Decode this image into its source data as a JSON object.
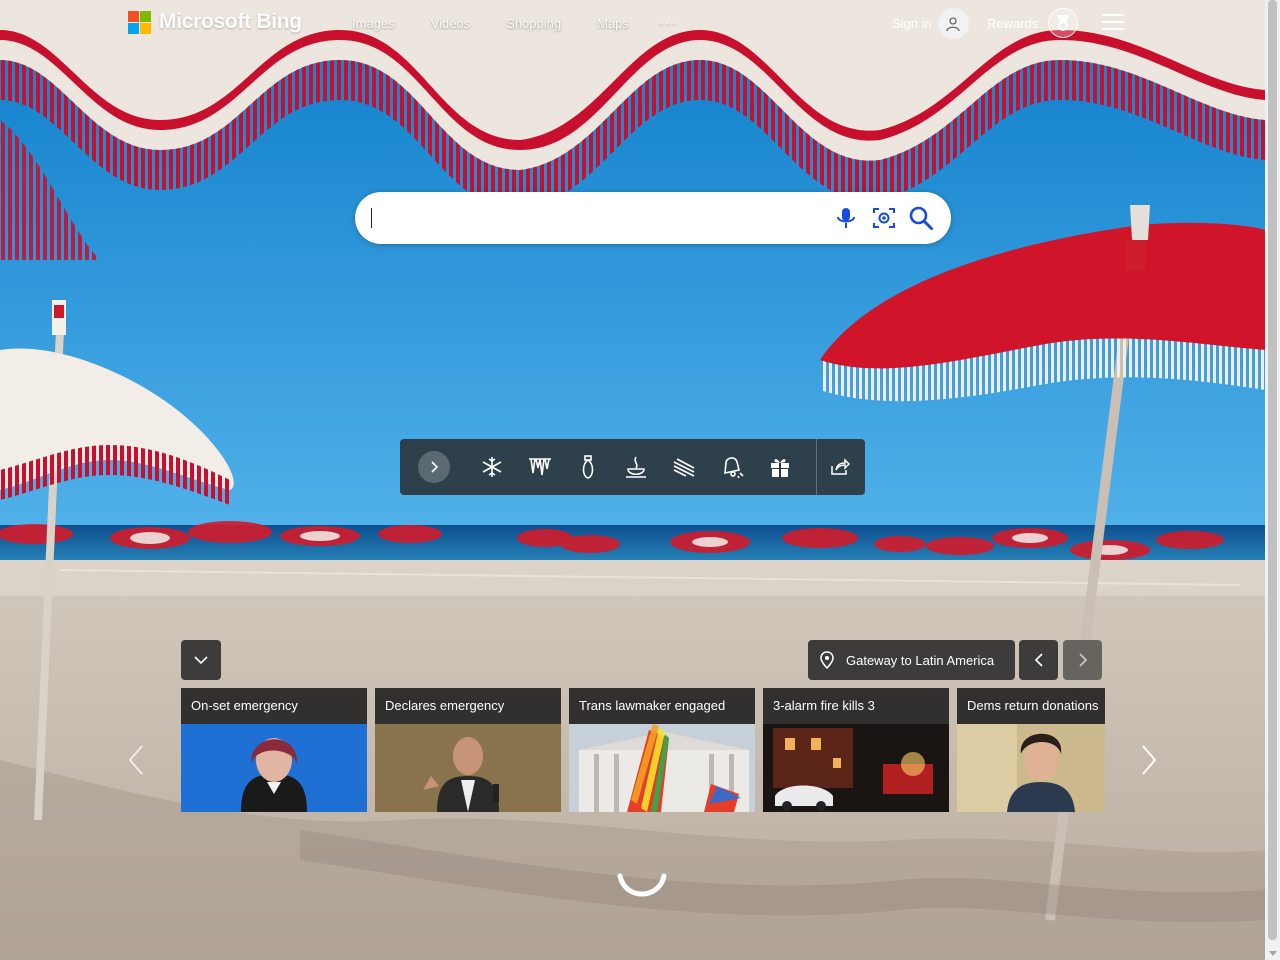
{
  "header": {
    "brand": "Microsoft Bing",
    "logo_colors": [
      "#f25022",
      "#7fba00",
      "#00a4ef",
      "#ffb900"
    ],
    "nav": [
      "Images",
      "Videos",
      "Shopping",
      "Maps"
    ],
    "more_label": "···",
    "signin_label": "Sign in",
    "rewards_label": "Rewards"
  },
  "search": {
    "value": "",
    "icons": [
      "microphone-icon",
      "visual-search-icon",
      "search-icon"
    ]
  },
  "wallpaper_toolbar": {
    "icons": [
      "next-arrow-icon",
      "snowflake-icon",
      "icicles-icon",
      "ornament-icon",
      "hot-drink-icon",
      "wind-icon",
      "bell-icon",
      "gift-icon",
      "share-icon"
    ]
  },
  "location_label": "Gateway to Latin America",
  "news": [
    {
      "title": "On-set emergency"
    },
    {
      "title": "Declares emergency"
    },
    {
      "title": "Trans lawmaker engaged"
    },
    {
      "title": "3-alarm fire kills 3"
    },
    {
      "title": "Dems return donations"
    }
  ],
  "colors": {
    "sky": "#1d8fd6",
    "umbrella_red": "#d01526",
    "sand": "#c7bdb0",
    "toolbar_bg": "#282828"
  }
}
